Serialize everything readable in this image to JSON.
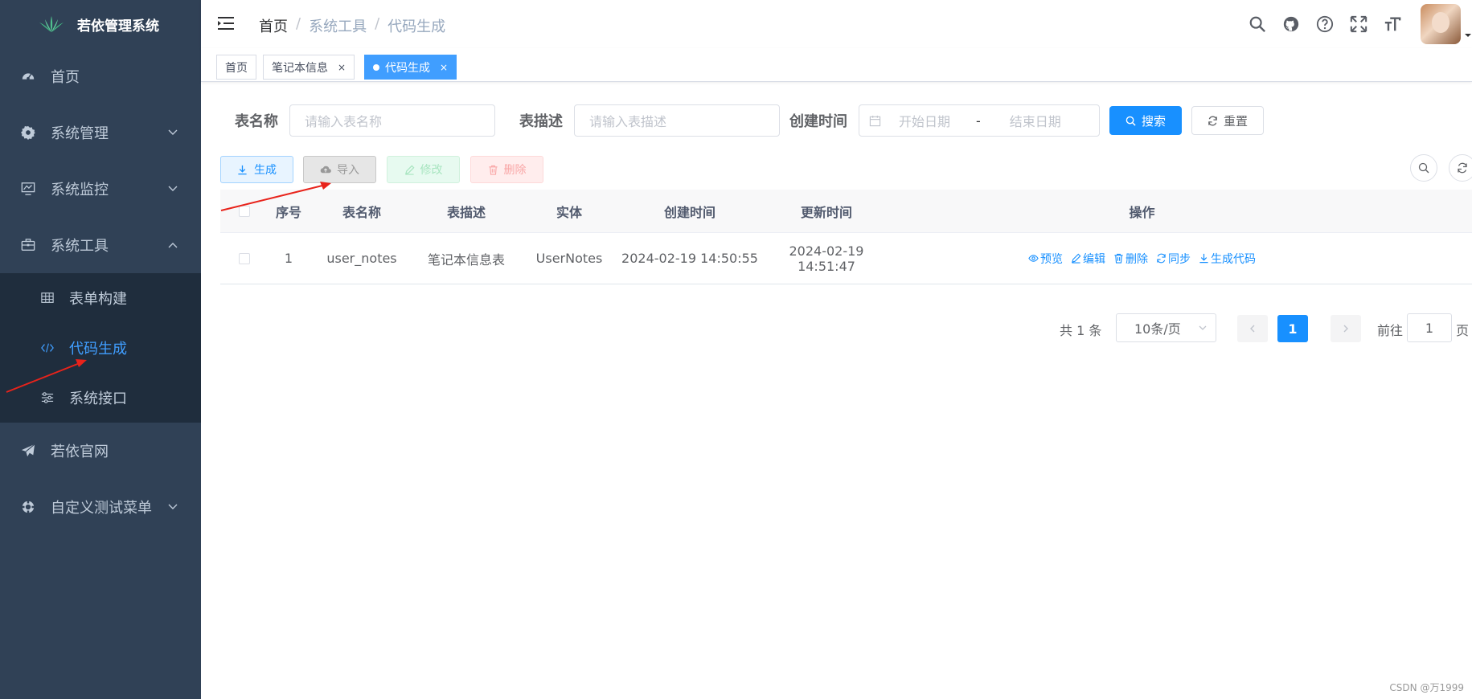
{
  "app": {
    "title": "若依管理系统"
  },
  "sidebar": {
    "items": [
      {
        "label": "首页",
        "icon": "dashboard-icon"
      },
      {
        "label": "系统管理",
        "icon": "gear-icon"
      },
      {
        "label": "系统监控",
        "icon": "monitor-icon"
      },
      {
        "label": "系统工具",
        "icon": "toolbox-icon"
      }
    ],
    "tools_sub": [
      {
        "label": "表单构建",
        "icon": "table-icon"
      },
      {
        "label": "代码生成",
        "icon": "code-icon"
      },
      {
        "label": "系统接口",
        "icon": "sliders-icon"
      }
    ],
    "bottom": [
      {
        "label": "若依官网",
        "icon": "send-icon"
      },
      {
        "label": "自定义测试菜单",
        "icon": "help-ring-icon"
      }
    ]
  },
  "breadcrumb": {
    "home": "首页",
    "sep": "/",
    "level1": "系统工具",
    "level2": "代码生成"
  },
  "tags": [
    {
      "label": "首页"
    },
    {
      "label": "笔记本信息",
      "close": "×"
    },
    {
      "label": "代码生成",
      "close": "×"
    }
  ],
  "search": {
    "table_name_label": "表名称",
    "table_name_placeholder": "请输入表名称",
    "table_desc_label": "表描述",
    "table_desc_placeholder": "请输入表描述",
    "time_label": "创建时间",
    "start_placeholder": "开始日期",
    "range_sep": "-",
    "end_placeholder": "结束日期",
    "search_btn": "搜索",
    "reset_btn": "重置"
  },
  "toolbar": {
    "generate": "生成",
    "import": "导入",
    "edit": "修改",
    "delete": "删除"
  },
  "table": {
    "headers": [
      "序号",
      "表名称",
      "表描述",
      "实体",
      "创建时间",
      "更新时间",
      "操作"
    ],
    "rows": [
      {
        "index": "1",
        "table_name": "user_notes",
        "table_desc": "笔记本信息表",
        "entity": "UserNotes",
        "create_time": "2024-02-19 14:50:55",
        "update_time": "2024-02-19 14:51:47"
      }
    ],
    "ops": [
      "预览",
      "编辑",
      "删除",
      "同步",
      "生成代码"
    ]
  },
  "pagination": {
    "total": "共 1 条",
    "page_size": "10条/页",
    "current": "1",
    "goto": "前往",
    "goto_value": "1",
    "page_suffix": "页"
  },
  "watermark": "CSDN @万1999",
  "colors": {
    "sidebar_bg": "#304156",
    "submenu_bg": "#1f2d3d",
    "primary": "#1890ff",
    "active_menu": "#409eff",
    "annotation_arrow": "#e8231b"
  }
}
